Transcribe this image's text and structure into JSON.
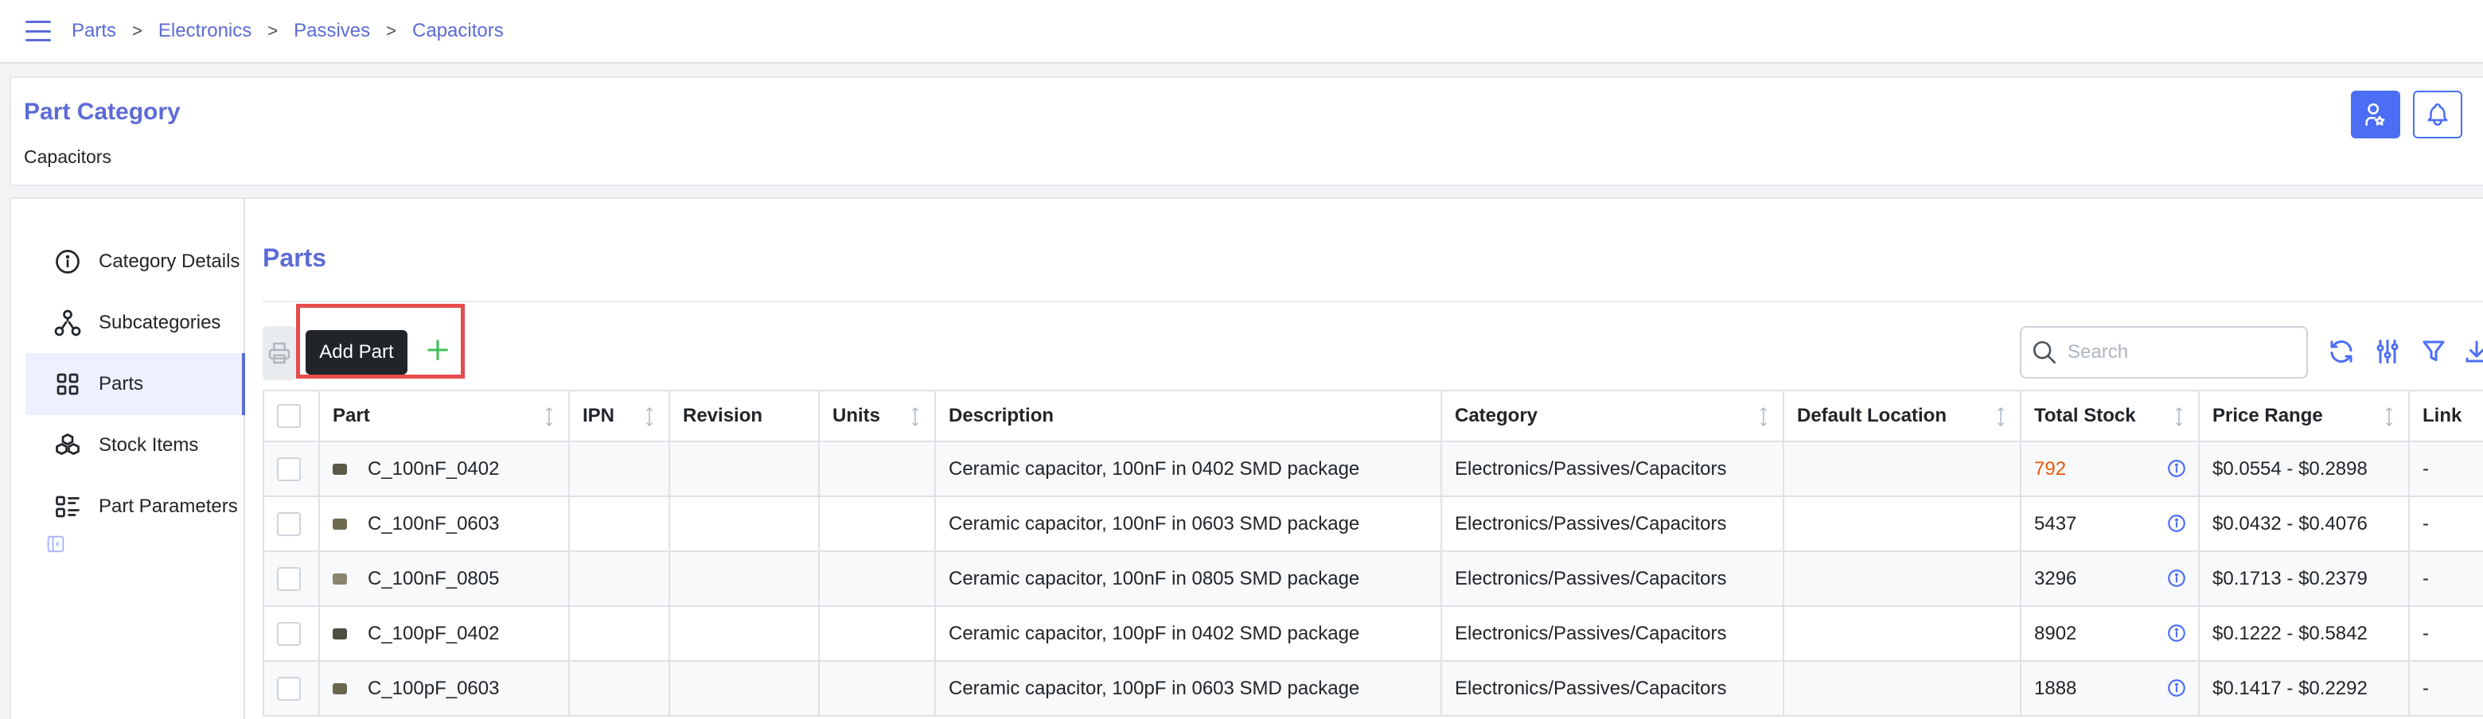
{
  "breadcrumbs": [
    "Parts",
    "Electronics",
    "Passives",
    "Capacitors"
  ],
  "breadcrumb_separator": ">",
  "category": {
    "title": "Part Category",
    "name": "Capacitors"
  },
  "sidebar": {
    "items": [
      {
        "label": "Category Details",
        "icon": "info-circle-icon"
      },
      {
        "label": "Subcategories",
        "icon": "sitemap-icon"
      },
      {
        "label": "Parts",
        "icon": "grid-icon",
        "active": true
      },
      {
        "label": "Stock Items",
        "icon": "boxes-icon"
      },
      {
        "label": "Part Parameters",
        "icon": "list-details-icon"
      }
    ]
  },
  "parts_panel": {
    "title": "Parts",
    "add_part_tooltip": "Add Part",
    "search_placeholder": "Search"
  },
  "table": {
    "columns": [
      "Part",
      "IPN",
      "Revision",
      "Units",
      "Description",
      "Category",
      "Default Location",
      "Total Stock",
      "Price Range",
      "Link"
    ],
    "rows": [
      {
        "part": "C_100nF_0402",
        "ipn": "",
        "revision": "",
        "units": "",
        "description": "Ceramic capacitor, 100nF in 0402 SMD package",
        "category": "Electronics/Passives/Capacitors",
        "location": "",
        "stock": "792",
        "stock_low": true,
        "price": "$0.0554 - $0.2898",
        "link": "-"
      },
      {
        "part": "C_100nF_0603",
        "ipn": "",
        "revision": "",
        "units": "",
        "description": "Ceramic capacitor, 100nF in 0603 SMD package",
        "category": "Electronics/Passives/Capacitors",
        "location": "",
        "stock": "5437",
        "stock_low": false,
        "price": "$0.0432 - $0.4076",
        "link": "-"
      },
      {
        "part": "C_100nF_0805",
        "ipn": "",
        "revision": "",
        "units": "",
        "description": "Ceramic capacitor, 100nF in 0805 SMD package",
        "category": "Electronics/Passives/Capacitors",
        "location": "",
        "stock": "3296",
        "stock_low": false,
        "price": "$0.1713 - $0.2379",
        "link": "-"
      },
      {
        "part": "C_100pF_0402",
        "ipn": "",
        "revision": "",
        "units": "",
        "description": "Ceramic capacitor, 100pF in 0402 SMD package",
        "category": "Electronics/Passives/Capacitors",
        "location": "",
        "stock": "8902",
        "stock_low": false,
        "price": "$0.1222 - $0.5842",
        "link": "-"
      },
      {
        "part": "C_100pF_0603",
        "ipn": "",
        "revision": "",
        "units": "",
        "description": "Ceramic capacitor, 100pF in 0603 SMD package",
        "category": "Electronics/Passives/Capacitors",
        "location": "",
        "stock": "1888",
        "stock_low": false,
        "price": "$0.1417 - $0.2292",
        "link": "-"
      }
    ]
  },
  "colors": {
    "accent": "#5c6bd6",
    "primary_button": "#4c6ef5",
    "add_icon": "#40c057",
    "low_stock": "#e8590c",
    "highlight_border": "#e74c4c"
  }
}
